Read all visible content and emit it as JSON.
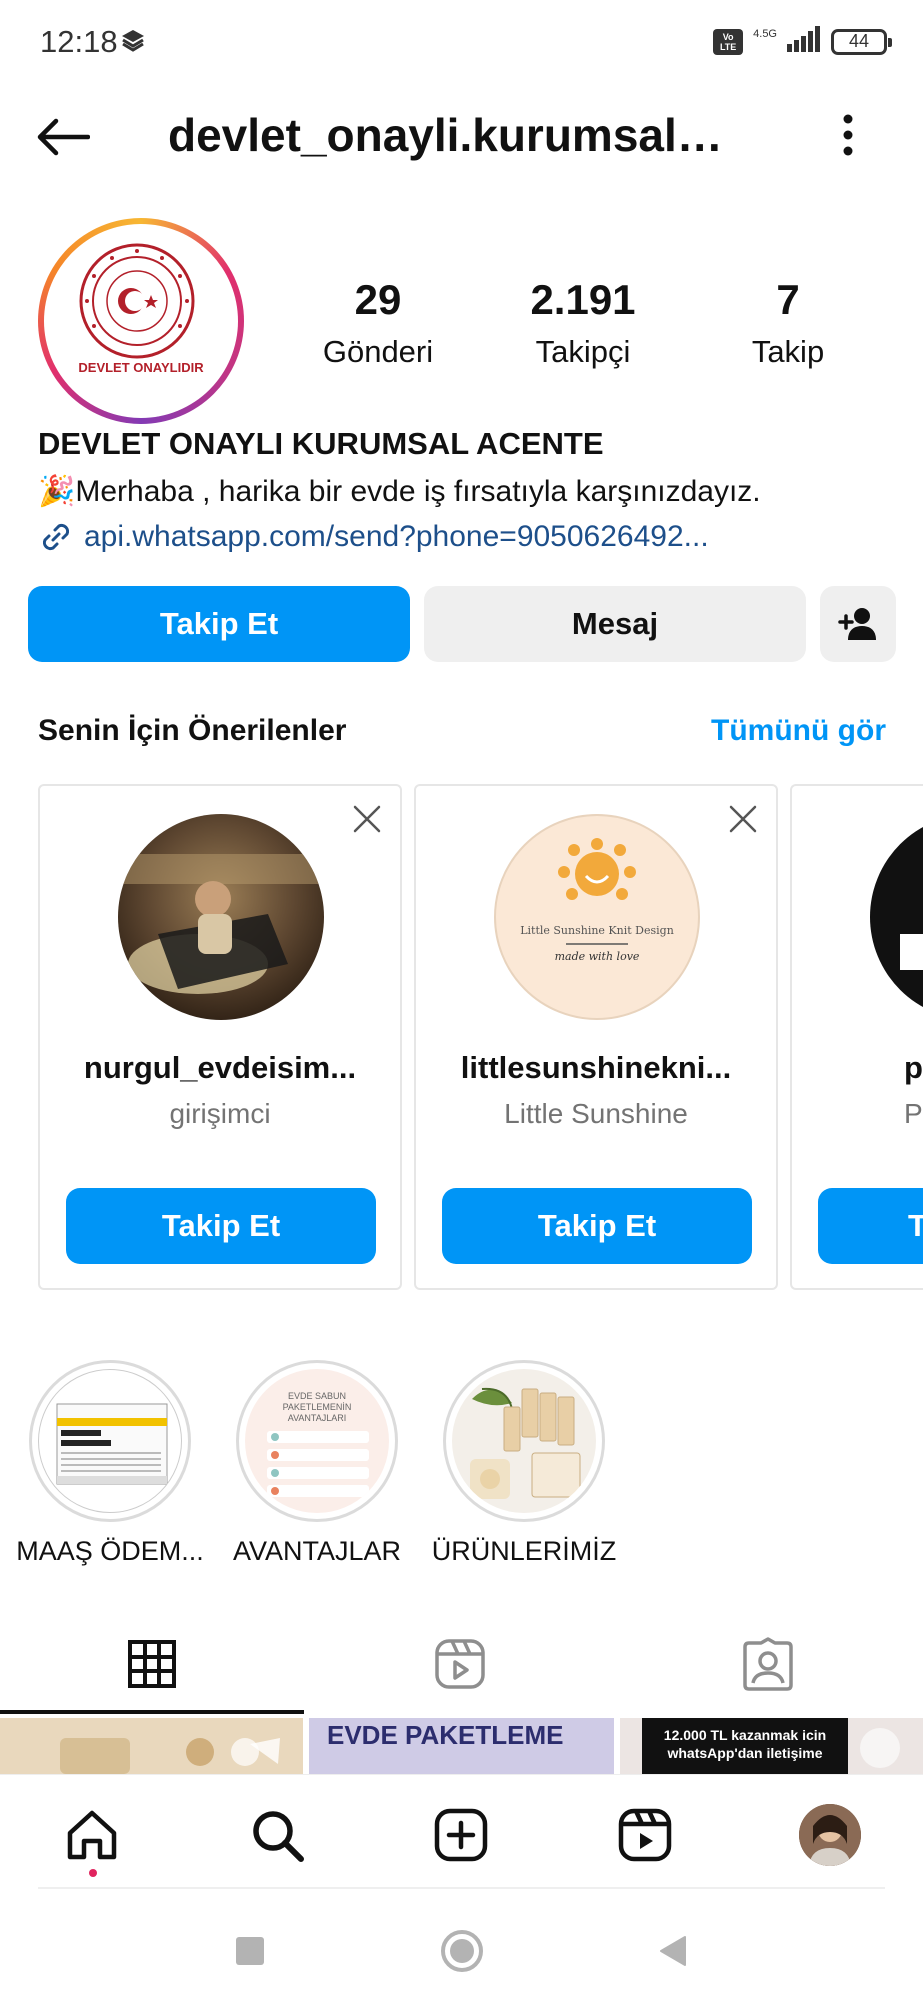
{
  "status_bar": {
    "time": "12:18",
    "volte_top": "Vo",
    "volte_bottom": "LTE",
    "network": "4.5G",
    "battery": "44"
  },
  "header": {
    "username": "devlet_onayli.kurumsal_a..."
  },
  "profile": {
    "avatar_text": "DEVLET ONAYLIDIR",
    "stats": [
      {
        "value": "29",
        "label": "Gönderi"
      },
      {
        "value": "2.191",
        "label": "Takipçi"
      },
      {
        "value": "7",
        "label": "Takip"
      }
    ],
    "name": "DEVLET ONAYLI KURUMSAL ACENTE",
    "bio": "🎉Merhaba , harika bir evde iş fırsatıyla karşınızdayız.",
    "link": "api.whatsapp.com/send?phone=9050626492..."
  },
  "actions": {
    "follow": "Takip Et",
    "message": "Mesaj"
  },
  "suggestions": {
    "title": "Senin İçin Önerilenler",
    "see_all": "Tümünü gör",
    "cards": [
      {
        "username": "nurgul_evdeisim...",
        "subtitle": "girişimci",
        "follow": "Takip Et",
        "avatar_text": ""
      },
      {
        "username": "littlesunshinekni...",
        "subtitle": "Little Sunshine",
        "follow": "Takip Et",
        "avatar_text": "Little Sunshine Knit Design",
        "avatar_text2": "made with love"
      },
      {
        "username": "p",
        "subtitle": "P",
        "follow": "T",
        "avatar_text": ""
      }
    ]
  },
  "highlights": [
    {
      "label": "MAAŞ ÖDEM..."
    },
    {
      "label": "AVANTAJLAR",
      "img_title": "EVDE SABUN PAKETLEMENİN AVANTAJLARI"
    },
    {
      "label": "ÜRÜNLERİMİZ"
    }
  ],
  "grid_preview": {
    "thumb2_text": "EVDE PAKETLEME",
    "thumb3_text": "12.000 TL kazanmak icin whatsApp'dan iletişime"
  },
  "colors": {
    "accent": "#0095f6",
    "link": "#1d4f8a",
    "notification_dot": "#e0245e"
  }
}
